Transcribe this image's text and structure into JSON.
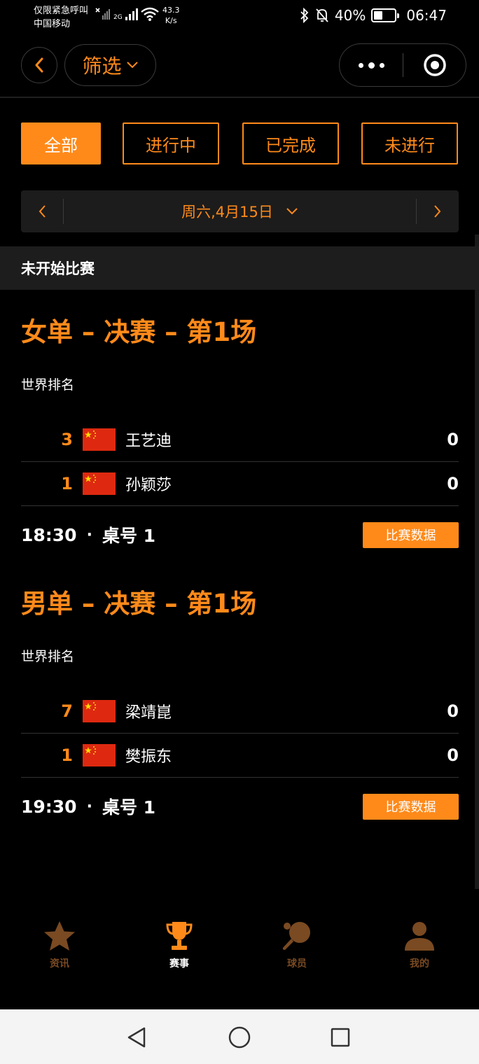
{
  "status_bar": {
    "emergency_text": "仅限紧急呼叫",
    "carrier": "中国移动",
    "net_speed_value": "43.3",
    "net_speed_unit": "K/s",
    "net_type": "2G",
    "battery_percent": "40%",
    "battery_level": 0.4,
    "time": "06:47"
  },
  "nav": {
    "filter_label": "筛选"
  },
  "tabs": [
    {
      "label": "全部",
      "active": true
    },
    {
      "label": "进行中",
      "active": false
    },
    {
      "label": "已完成",
      "active": false
    },
    {
      "label": "未进行",
      "active": false
    }
  ],
  "date_bar": {
    "date_label": "周六,4月15日"
  },
  "section": {
    "title": "未开始比赛"
  },
  "matches": [
    {
      "title": "女单 – 决赛 – 第1场",
      "rank_label": "世界排名",
      "players": [
        {
          "rank": "3",
          "name": "王艺迪",
          "score": "0"
        },
        {
          "rank": "1",
          "name": "孙颖莎",
          "score": "0"
        }
      ],
      "time": "18:30",
      "dot": "·",
      "table": "桌号 1",
      "data_button": "比赛数据"
    },
    {
      "title": "男单 – 决赛 – 第1场",
      "rank_label": "世界排名",
      "players": [
        {
          "rank": "7",
          "name": "梁靖崑",
          "score": "0"
        },
        {
          "rank": "1",
          "name": "樊振东",
          "score": "0"
        }
      ],
      "time": "19:30",
      "dot": "·",
      "table": "桌号 1",
      "data_button": "比赛数据"
    }
  ],
  "bottom_tabs": [
    {
      "label": "资讯",
      "icon": "star-icon",
      "active": false
    },
    {
      "label": "赛事",
      "icon": "trophy-icon",
      "active": true
    },
    {
      "label": "球员",
      "icon": "paddle-icon",
      "active": false
    },
    {
      "label": "我的",
      "icon": "user-icon",
      "active": false
    }
  ],
  "colors": {
    "accent": "#ff8a1a",
    "background": "#000000",
    "inactive_tab": "#7a4a22"
  }
}
